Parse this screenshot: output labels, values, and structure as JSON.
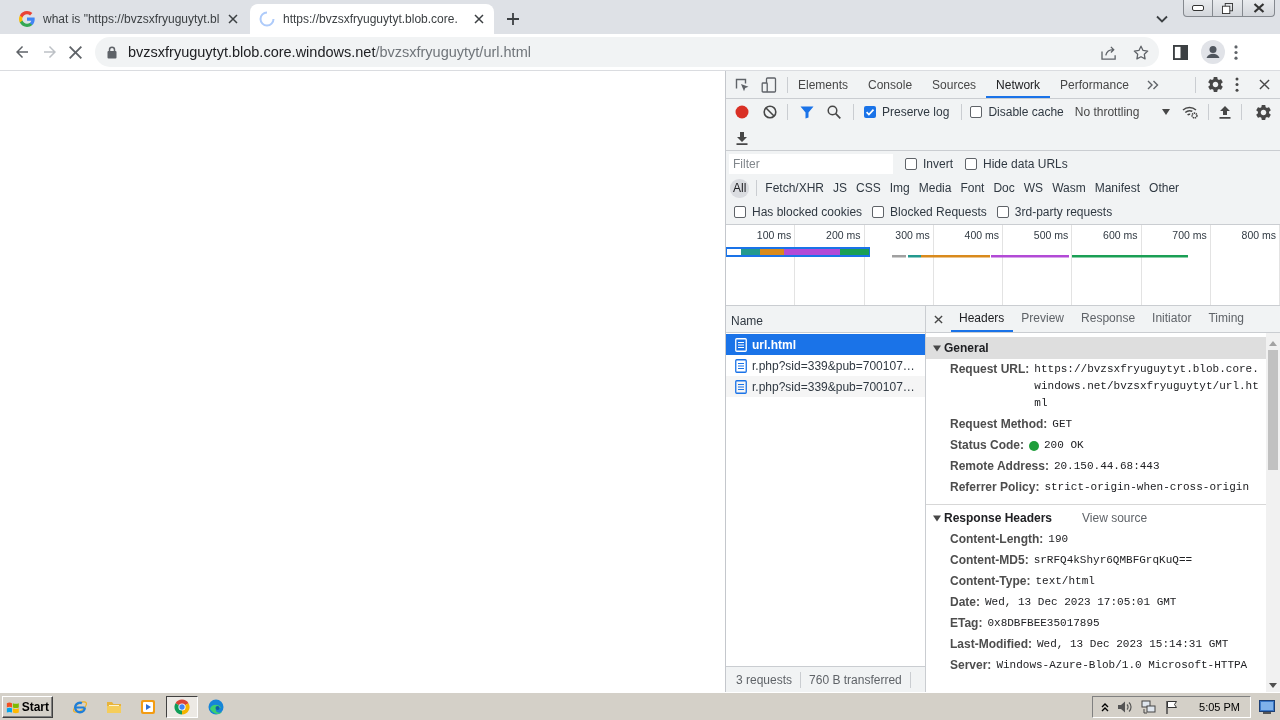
{
  "browser_tabs": [
    {
      "title": "what is \"https://bvzsxfryuguytyt.bl",
      "kind": "search",
      "selected": false
    },
    {
      "title": "https://bvzsxfryuguytyt.blob.core.",
      "kind": "loading",
      "selected": true
    }
  ],
  "address_bar": {
    "host": "bvzsxfryuguytyt.blob.core.windows.net",
    "path": "/bvzsxfryuguytyt/url.html",
    "loading": true
  },
  "devtools": {
    "panel_tabs": [
      {
        "label": "Elements",
        "selected": false
      },
      {
        "label": "Console",
        "selected": false
      },
      {
        "label": "Sources",
        "selected": false
      },
      {
        "label": "Network",
        "selected": true
      },
      {
        "label": "Performance",
        "selected": false
      }
    ],
    "toolbar": {
      "recording": true,
      "preserve_log": {
        "label": "Preserve log",
        "checked": true
      },
      "disable_cache": {
        "label": "Disable cache",
        "checked": false
      },
      "throttling": "No throttling"
    },
    "filter": {
      "placeholder": "Filter",
      "options": [
        {
          "label": "Invert",
          "checked": false
        },
        {
          "label": "Hide data URLs",
          "checked": false
        }
      ]
    },
    "type_filters": [
      {
        "label": "All",
        "selected": true
      },
      {
        "label": "Fetch/XHR",
        "selected": false
      },
      {
        "label": "JS",
        "selected": false
      },
      {
        "label": "CSS",
        "selected": false
      },
      {
        "label": "Img",
        "selected": false
      },
      {
        "label": "Media",
        "selected": false
      },
      {
        "label": "Font",
        "selected": false
      },
      {
        "label": "Doc",
        "selected": false
      },
      {
        "label": "WS",
        "selected": false
      },
      {
        "label": "Wasm",
        "selected": false
      },
      {
        "label": "Manifest",
        "selected": false
      },
      {
        "label": "Other",
        "selected": false
      }
    ],
    "request_filters": [
      {
        "label": "Has blocked cookies",
        "checked": false
      },
      {
        "label": "Blocked Requests",
        "checked": false
      },
      {
        "label": "3rd-party requests",
        "checked": false
      }
    ],
    "overview": {
      "ticks": [
        "100 ms",
        "200 ms",
        "300 ms",
        "400 ms",
        "500 ms",
        "600 ms",
        "700 ms",
        "800 ms"
      ]
    },
    "requests": {
      "column": "Name",
      "rows": [
        {
          "name": "url.html",
          "selected": true
        },
        {
          "name": "r.php?sid=339&pub=700107…",
          "selected": false
        },
        {
          "name": "r.php?sid=339&pub=700107…",
          "selected": false
        }
      ],
      "summary": [
        "3 requests",
        "760 B transferred"
      ]
    },
    "details": {
      "tabs": [
        {
          "label": "Headers",
          "selected": true
        },
        {
          "label": "Preview",
          "selected": false
        },
        {
          "label": "Response",
          "selected": false
        },
        {
          "label": "Initiator",
          "selected": false
        },
        {
          "label": "Timing",
          "selected": false
        }
      ],
      "sections": [
        {
          "title": "General",
          "expanded": true,
          "highlighted": true,
          "rows": [
            {
              "kind": "plain",
              "label": "Request URL:",
              "value": "https://bvzsxfryuguytyt.blob.core.windows.net/bvzsxfryuguytyt/url.html"
            },
            {
              "kind": "plain",
              "label": "Request Method:",
              "value": "GET"
            },
            {
              "kind": "status",
              "label": "Status Code:",
              "value": "200 OK",
              "color": "#1e9e3a"
            },
            {
              "kind": "plain",
              "label": "Remote Address:",
              "value": "20.150.44.68:443"
            },
            {
              "kind": "plain",
              "label": "Referrer Policy:",
              "value": "strict-origin-when-cross-origin"
            }
          ]
        },
        {
          "title": "Response Headers",
          "expanded": true,
          "highlighted": false,
          "link": "View source",
          "rows": [
            {
              "kind": "plain",
              "label": "Content-Length:",
              "value": "190"
            },
            {
              "kind": "plain",
              "label": "Content-MD5:",
              "value": "srRFQ4kShyr6QMBFGrqKuQ=="
            },
            {
              "kind": "plain",
              "label": "Content-Type:",
              "value": "text/html"
            },
            {
              "kind": "plain",
              "label": "Date:",
              "value": "Wed, 13 Dec 2023 17:05:01 GMT"
            },
            {
              "kind": "plain",
              "label": "ETag:",
              "value": "0x8DBFBEE35017895"
            },
            {
              "kind": "plain",
              "label": "Last-Modified:",
              "value": "Wed, 13 Dec 2023 15:14:31 GMT"
            },
            {
              "kind": "plain",
              "label": "Server:",
              "value": "Windows-Azure-Blob/1.0 Microsoft-HTTPA"
            }
          ]
        }
      ]
    }
  },
  "taskbar": {
    "start": "Start",
    "apps": [
      {
        "kind": "ie",
        "selected": false
      },
      {
        "kind": "explorer",
        "selected": false
      },
      {
        "kind": "media",
        "selected": false
      },
      {
        "kind": "chrome",
        "selected": true
      },
      {
        "kind": "edge",
        "selected": false
      }
    ],
    "clock": "5:05 PM"
  }
}
